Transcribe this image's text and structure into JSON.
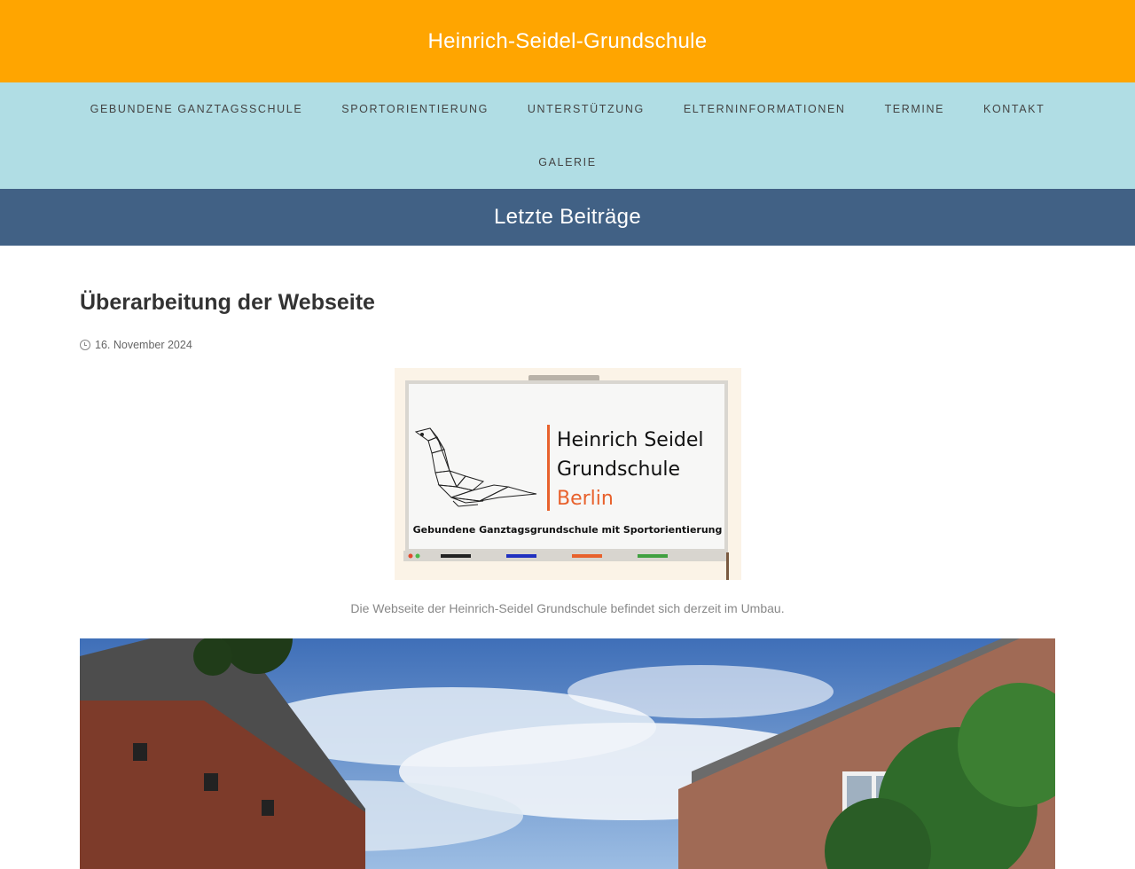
{
  "site": {
    "title": "Heinrich-Seidel-Grundschule"
  },
  "nav": {
    "row1": [
      {
        "label": "Gebundene Ganztagsschule"
      },
      {
        "label": "Sportorientierung"
      },
      {
        "label": "Unterstützung"
      },
      {
        "label": "Elterninformationen"
      },
      {
        "label": "Termine"
      },
      {
        "label": "Kontakt"
      }
    ],
    "row2": [
      {
        "label": "Galerie"
      }
    ]
  },
  "page": {
    "heading": "Letzte Beiträge"
  },
  "post": {
    "title": "Überarbeitung der Webseite",
    "date": "16. November 2024",
    "caption": "Die Webseite der Heinrich-Seidel Grundschule befindet sich derzeit im Umbau."
  },
  "logo": {
    "line1": "Heinrich Seidel",
    "line2": "Grundschule",
    "line3": "Berlin",
    "tagline": "Gebundene Ganztagsgrundschule mit Sportorientierung"
  },
  "colors": {
    "topbar": "#ffa500",
    "nav": "#b0dde4",
    "pagebar": "#416185",
    "logo_accent": "#e8612c"
  }
}
